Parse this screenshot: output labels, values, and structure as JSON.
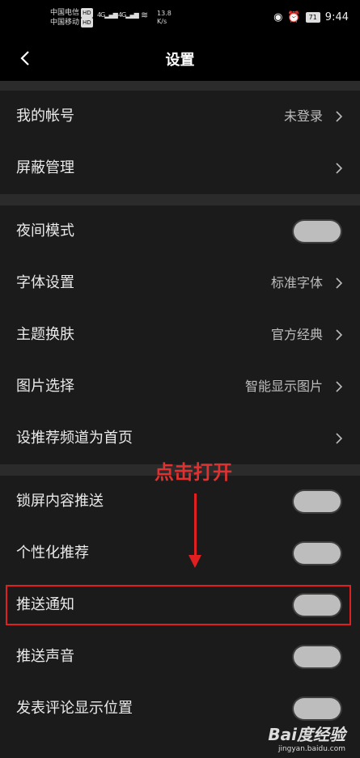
{
  "status": {
    "carrier1": "中国电信",
    "carrier2": "中国移动",
    "hd": "HD",
    "signal1": "4G",
    "signal2": "4G",
    "speed_value": "13.8",
    "speed_unit": "K/s",
    "battery": "71",
    "time": "9:44"
  },
  "header": {
    "title": "设置"
  },
  "settings": {
    "account": {
      "label": "我的帐号",
      "value": "未登录"
    },
    "block": {
      "label": "屏蔽管理"
    },
    "night_mode": {
      "label": "夜间模式"
    },
    "font": {
      "label": "字体设置",
      "value": "标准字体"
    },
    "theme": {
      "label": "主题换肤",
      "value": "官方经典"
    },
    "image": {
      "label": "图片选择",
      "value": "智能显示图片"
    },
    "home_channel": {
      "label": "设推荐频道为首页"
    },
    "lock_push": {
      "label": "锁屏内容推送"
    },
    "personal": {
      "label": "个性化推荐"
    },
    "push_notify": {
      "label": "推送通知"
    },
    "push_sound": {
      "label": "推送声音"
    },
    "comment_location": {
      "label": "发表评论显示位置"
    }
  },
  "annotation": {
    "text": "点击打开"
  },
  "watermark": {
    "logo": "Bai度经验",
    "url": "jingyan.baidu.com"
  }
}
